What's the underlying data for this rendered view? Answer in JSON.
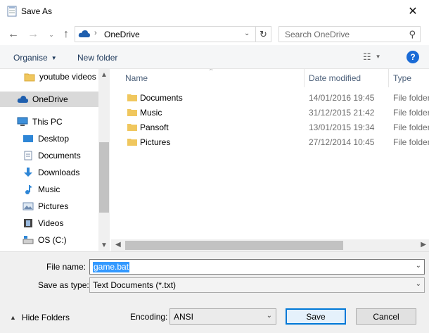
{
  "window": {
    "title": "Save As"
  },
  "address": {
    "location": "OneDrive"
  },
  "search": {
    "placeholder": "Search OneDrive"
  },
  "toolbar": {
    "organise": "Organise",
    "new_folder": "New folder"
  },
  "nav": {
    "items": [
      {
        "label": "youtube videos",
        "icon": "folder-icon"
      },
      {
        "label": "OneDrive",
        "icon": "cloud-icon",
        "selected": true
      },
      {
        "label": "This PC",
        "icon": "computer-icon"
      },
      {
        "label": "Desktop",
        "icon": "desktop-icon"
      },
      {
        "label": "Documents",
        "icon": "documents-icon"
      },
      {
        "label": "Downloads",
        "icon": "download-icon"
      },
      {
        "label": "Music",
        "icon": "music-icon"
      },
      {
        "label": "Pictures",
        "icon": "pictures-icon"
      },
      {
        "label": "Videos",
        "icon": "videos-icon"
      },
      {
        "label": "OS (C:)",
        "icon": "drive-icon"
      }
    ]
  },
  "columns": {
    "name": "Name",
    "date": "Date modified",
    "type": "Type"
  },
  "files": [
    {
      "name": "Documents",
      "date": "14/01/2016 19:45",
      "type": "File folder"
    },
    {
      "name": "Music",
      "date": "31/12/2015 21:42",
      "type": "File folder"
    },
    {
      "name": "Pansoft",
      "date": "13/01/2015 19:34",
      "type": "File folder"
    },
    {
      "name": "Pictures",
      "date": "27/12/2014 10:45",
      "type": "File folder"
    }
  ],
  "form": {
    "file_name_label": "File name:",
    "file_name_value": "game.bat",
    "save_type_label": "Save as type:",
    "save_type_value": "Text Documents (*.txt)",
    "encoding_label": "Encoding:",
    "encoding_value": "ANSI"
  },
  "buttons": {
    "hide_folders": "Hide Folders",
    "save": "Save",
    "cancel": "Cancel"
  },
  "colors": {
    "accent": "#0078d7",
    "selection": "#3399ff",
    "folder": "#f0c75e"
  }
}
